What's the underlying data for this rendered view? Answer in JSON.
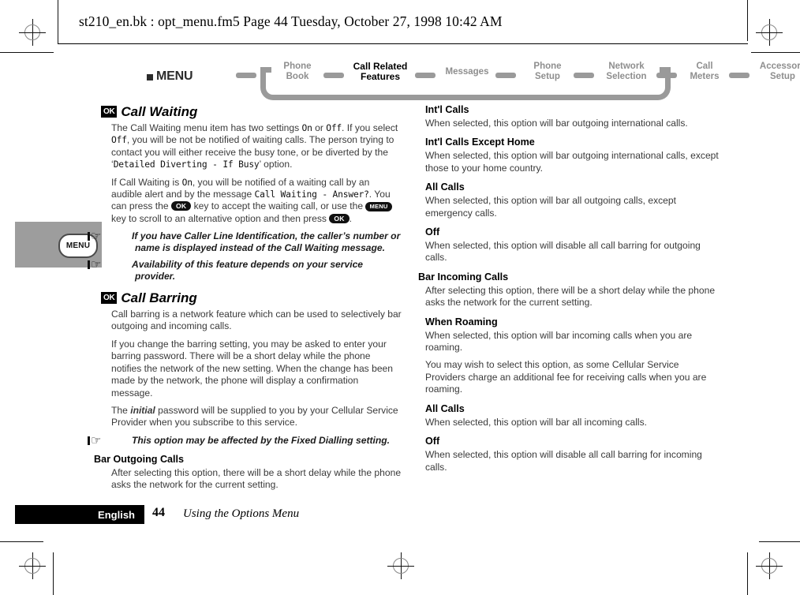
{
  "header": {
    "file_line": "st210_en.bk : opt_menu.fm5  Page 44  Tuesday, October 27, 1998  10:42 AM"
  },
  "nav": {
    "menu_label": "MENU",
    "items": [
      {
        "label_line1": "Phone",
        "label_line2": "Book",
        "active": false
      },
      {
        "label_line1": "Call Related",
        "label_line2": "Features",
        "active": true
      },
      {
        "label_line1": "Messages",
        "label_line2": "",
        "active": false
      },
      {
        "label_line1": "Phone",
        "label_line2": "Setup",
        "active": false
      },
      {
        "label_line1": "Network",
        "label_line2": "Selection",
        "active": false
      },
      {
        "label_line1": "Call",
        "label_line2": "Meters",
        "active": false
      },
      {
        "label_line1": "Accessory",
        "label_line2": "Setup",
        "active": false
      }
    ]
  },
  "side_tab": {
    "key_label": "MENU"
  },
  "left_column": {
    "section1": {
      "badge": "OK",
      "title": "Call Waiting",
      "para1_a": "The Call Waiting menu item has two settings ",
      "para1_code1": "On",
      "para1_b": " or ",
      "para1_code2": "Off",
      "para1_c": ". If you select ",
      "para1_code3": "Off",
      "para1_d": ", you will be not be notified of waiting calls. The person trying to contact you will either receive the busy tone, or be diverted by the ‘",
      "para1_code4": "Detailed Diverting - If Busy",
      "para1_e": "’ option.",
      "para2_a": "If Call Waiting is ",
      "para2_code1": "On",
      "para2_b": ", you will be notified of a waiting call by an audible alert and by the message ",
      "para2_code2": "Call Waiting - Answer?",
      "para2_c": ". You can press the ",
      "para2_key1": "OK",
      "para2_d": " key to accept the waiting call, or use the ",
      "para2_key2": "MENU",
      "para2_e": " key to scroll to an alternative option and then press ",
      "para2_key3": "OK",
      "para2_f": ".",
      "note1": "If you have Caller Line Identification, the caller’s number or name is displayed instead of the Call Waiting message.",
      "note2": "Availability of this feature depends on your service provider."
    },
    "section2": {
      "badge": "OK",
      "title": "Call Barring",
      "para1": "Call barring is a network feature which can be used to selectively bar outgoing and incoming calls.",
      "para2": "If you change the barring setting, you may be asked to enter your barring password. There will be a short delay while the phone notifies the network of the new setting. When the change has been made by the network, the phone will display a confirmation message.",
      "para3_a": "The ",
      "para3_em": "initial",
      "para3_b": " password will be supplied to you by your Cellular Service Provider when you subscribe to this service.",
      "note1": "This option may be affected by the Fixed Dialling setting.",
      "sub1_title": "Bar Outgoing Calls",
      "sub1_body": "After selecting this option, there will be a short delay while the phone asks the network for the current setting."
    }
  },
  "right_column": {
    "items": [
      {
        "title": "Int'l Calls",
        "paras": [
          "When selected, this option will bar outgoing international calls."
        ],
        "outdent": false
      },
      {
        "title": "Int'l Calls Except Home",
        "paras": [
          "When selected, this option will bar outgoing international calls, except those to your home country."
        ],
        "outdent": false
      },
      {
        "title": "All Calls",
        "paras": [
          "When selected, this option will bar all outgoing calls, except emergency calls."
        ],
        "outdent": false
      },
      {
        "title": "Off",
        "paras": [
          "When selected, this option will disable all call barring for outgoing calls."
        ],
        "outdent": false
      },
      {
        "title": "Bar Incoming Calls",
        "paras": [
          "After selecting this option, there will be a short delay while the phone asks the network for the current setting."
        ],
        "outdent": true
      },
      {
        "title": "When Roaming",
        "paras": [
          "When selected, this option will bar incoming calls when you are roaming.",
          "You may wish to select this option, as some Cellular Service Providers charge an additional fee for receiving calls when you are roaming."
        ],
        "outdent": false
      },
      {
        "title": "All Calls",
        "paras": [
          "When selected, this option will bar all incoming calls."
        ],
        "outdent": false
      },
      {
        "title": "Off",
        "paras": [
          "When selected, this option will disable all call barring for incoming calls."
        ],
        "outdent": false
      }
    ]
  },
  "footer": {
    "language": "English",
    "page_number": "44",
    "chapter_title": "Using the Options Menu"
  },
  "colors": {
    "nav_inactive": "#8e8e8e",
    "nav_track": "#9a9a9a",
    "side_tab": "#9d9d9d",
    "body_text": "#3a3a3a"
  }
}
